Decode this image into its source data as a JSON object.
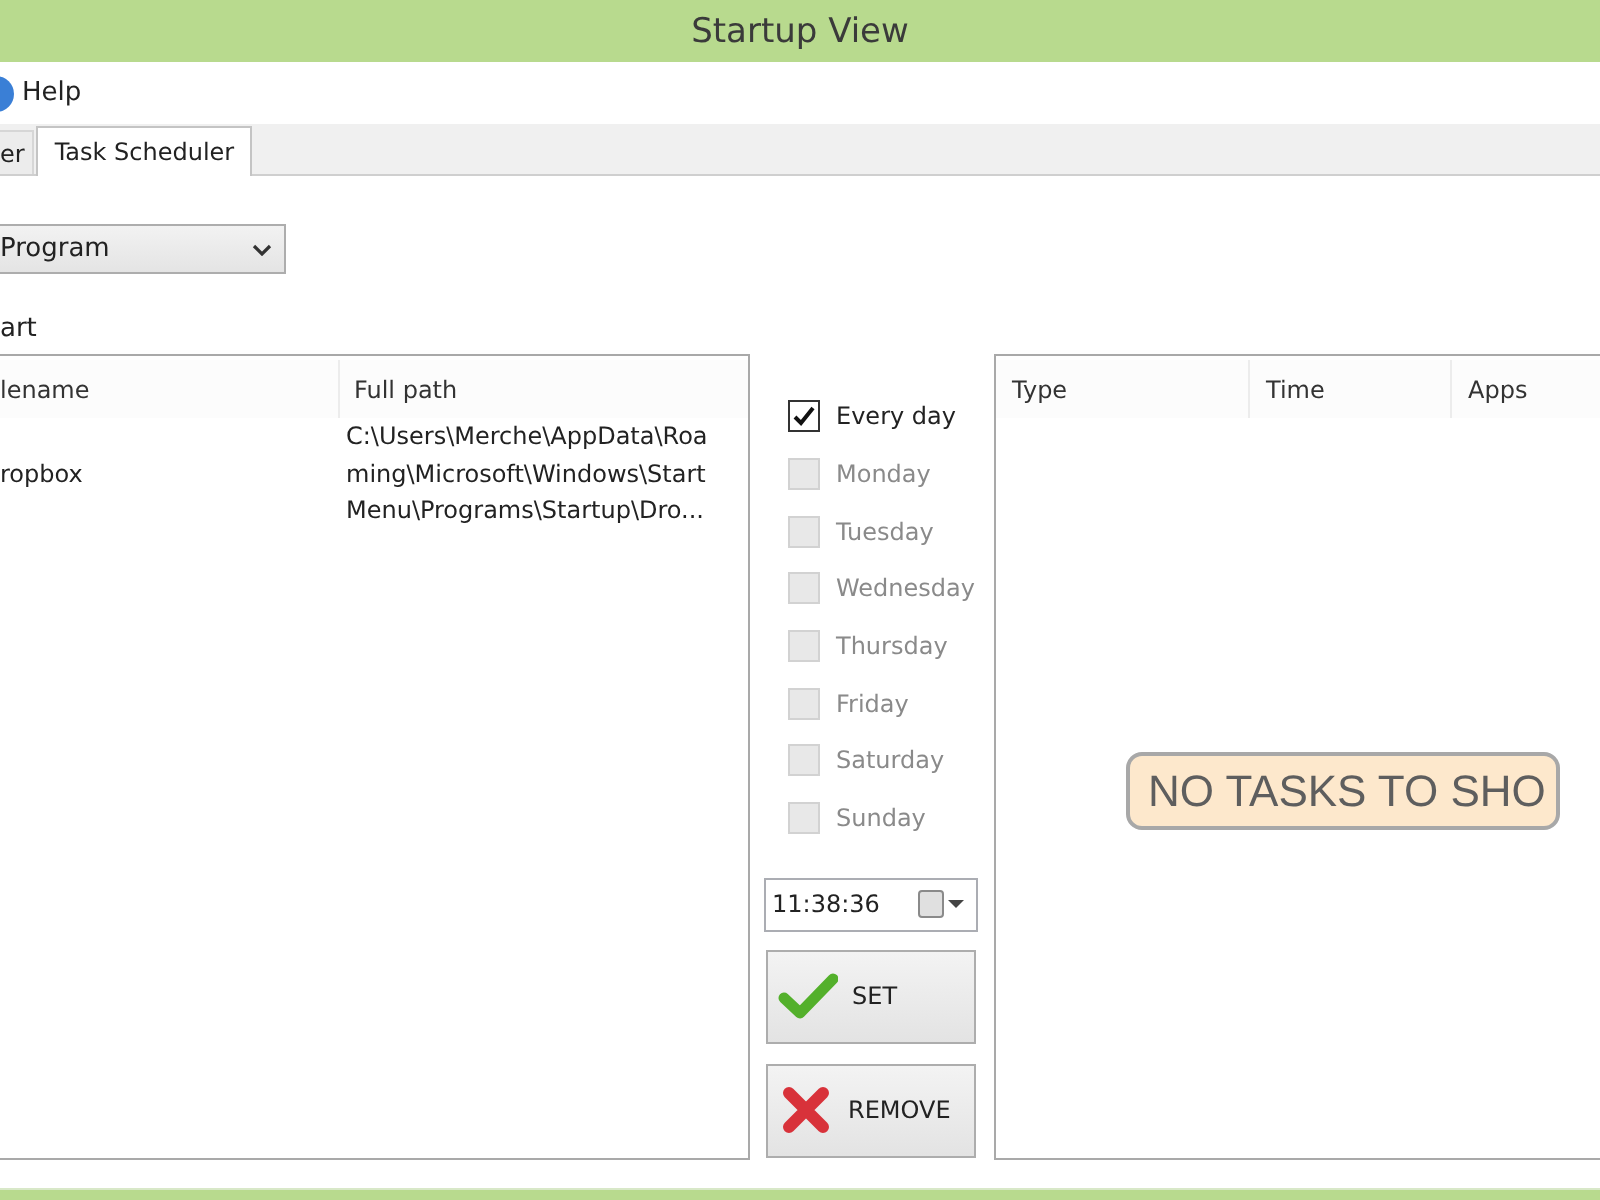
{
  "window": {
    "title": "Startup View"
  },
  "menu": [
    {
      "label": "Help"
    }
  ],
  "tabs": [
    {
      "label": "er",
      "selected": false
    },
    {
      "label": "Task Scheduler",
      "selected": true
    }
  ],
  "program_select": {
    "value": "Program"
  },
  "startup_list": {
    "label": "art",
    "columns": [
      "lename",
      "Full path"
    ],
    "rows": [
      [
        "ropbox",
        "C:\\Users\\Merche\\AppData\\Roaming\\Microsoft\\Windows\\Start Menu\\Programs\\Startup\\Dro..."
      ]
    ]
  },
  "days": [
    {
      "label": "Every day",
      "checked": true,
      "disabled": false
    },
    {
      "label": "Monday",
      "checked": false,
      "disabled": true
    },
    {
      "label": "Tuesday",
      "checked": false,
      "disabled": true
    },
    {
      "label": "Wednesday",
      "checked": false,
      "disabled": true
    },
    {
      "label": "Thursday",
      "checked": false,
      "disabled": true
    },
    {
      "label": "Friday",
      "checked": false,
      "disabled": true
    },
    {
      "label": "Saturday",
      "checked": false,
      "disabled": true
    },
    {
      "label": "Sunday",
      "checked": false,
      "disabled": true
    }
  ],
  "time_field": {
    "value": "11:38:36"
  },
  "buttons": [
    {
      "label": "SET",
      "kind": "set"
    },
    {
      "label": "REMOVE",
      "kind": "remove"
    }
  ],
  "tasks_list": {
    "columns": [
      "Type",
      "Time",
      "Apps"
    ],
    "empty_message": "NO TASKS TO SHO"
  }
}
